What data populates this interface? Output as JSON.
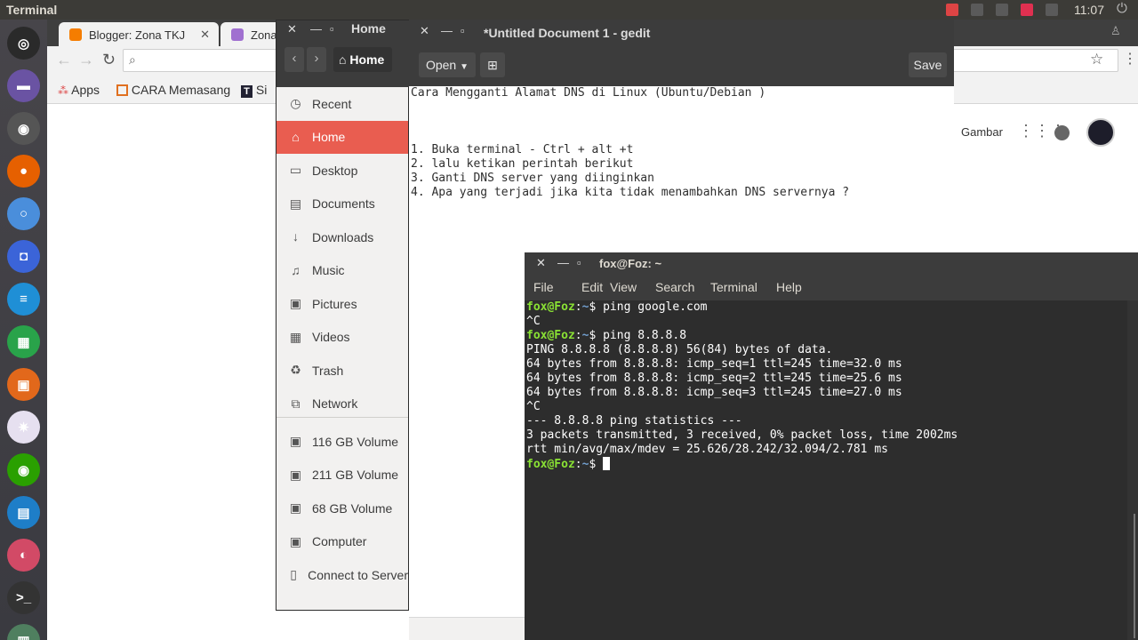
{
  "top_panel": {
    "app_title": "Terminal",
    "clock": "11:07",
    "indicators": [
      {
        "icon": "record-icon",
        "color": "#d44"
      },
      {
        "icon": "wifi-icon",
        "color": "#5a5a5a"
      },
      {
        "icon": "keyboard-en-icon",
        "color": "#5a5a5a"
      },
      {
        "icon": "battery-icon",
        "color": "#e03050"
      },
      {
        "icon": "volume-icon",
        "color": "#5a5a5a"
      }
    ]
  },
  "launcher": {
    "items": [
      {
        "name": "dash-icon",
        "color": "#2a2a2a",
        "glyph": "◎"
      },
      {
        "name": "files-icon",
        "color": "#6a53a3",
        "glyph": "▬"
      },
      {
        "name": "disk-icon",
        "color": "#555",
        "glyph": "◉"
      },
      {
        "name": "firefox-icon",
        "color": "#e66000",
        "glyph": "●"
      },
      {
        "name": "chromium-icon",
        "color": "#4a8edb",
        "glyph": "○"
      },
      {
        "name": "camera-icon",
        "color": "#3b64d8",
        "glyph": "◘"
      },
      {
        "name": "writer-icon",
        "color": "#1f8fd6",
        "glyph": "≡"
      },
      {
        "name": "calc-icon",
        "color": "#29a34a",
        "glyph": "▦"
      },
      {
        "name": "impress-icon",
        "color": "#e2681b",
        "glyph": "▣"
      },
      {
        "name": "atom-icon",
        "color": "#e6e0f0",
        "glyph": "✷"
      },
      {
        "name": "nvidia-icon",
        "color": "#2aa000",
        "glyph": "◉"
      },
      {
        "name": "monitor-icon",
        "color": "#1e7ec8",
        "glyph": "▤"
      },
      {
        "name": "toggle-icon",
        "color": "#d24a66",
        "glyph": "◐"
      },
      {
        "name": "terminal-icon",
        "color": "#333",
        "glyph": ">_"
      },
      {
        "name": "hardware-icon",
        "color": "#4f7f5f",
        "glyph": "▥"
      }
    ]
  },
  "browser": {
    "tabs": [
      {
        "label": "Blogger: Zona TKJ",
        "favicon_color": "#f57d00"
      },
      {
        "label": "Zona",
        "favicon_color": "#a070d0"
      }
    ],
    "bookmarks": [
      {
        "label": "Apps",
        "icon": "apps-grid-icon"
      },
      {
        "label": "CARA Memasang",
        "icon": "bookmark-c-icon"
      },
      {
        "label": "Si",
        "icon": "bookmark-t-icon"
      }
    ],
    "google_bar": {
      "images_label": "Gambar"
    }
  },
  "files": {
    "title": "Home",
    "path_button": "Home",
    "sidebar": [
      {
        "label": "Recent",
        "icon": "clock-icon",
        "glyph": "◷"
      },
      {
        "label": "Home",
        "icon": "home-icon",
        "glyph": "⌂",
        "active": true
      },
      {
        "label": "Desktop",
        "icon": "desktop-icon",
        "glyph": "▭"
      },
      {
        "label": "Documents",
        "icon": "document-icon",
        "glyph": "▤"
      },
      {
        "label": "Downloads",
        "icon": "download-icon",
        "glyph": "↓"
      },
      {
        "label": "Music",
        "icon": "music-icon",
        "glyph": "♫"
      },
      {
        "label": "Pictures",
        "icon": "picture-icon",
        "glyph": "▣"
      },
      {
        "label": "Videos",
        "icon": "video-icon",
        "glyph": "▦"
      },
      {
        "label": "Trash",
        "icon": "trash-icon",
        "glyph": "♻"
      },
      {
        "label": "Network",
        "icon": "network-icon",
        "glyph": "⧉"
      },
      {
        "label": "116 GB Volume",
        "icon": "drive-icon",
        "glyph": "▣"
      },
      {
        "label": "211 GB Volume",
        "icon": "drive-icon",
        "glyph": "▣"
      },
      {
        "label": "68 GB Volume",
        "icon": "drive-icon",
        "glyph": "▣"
      },
      {
        "label": "Computer",
        "icon": "computer-icon",
        "glyph": "▣"
      },
      {
        "label": "Connect to Server",
        "icon": "server-icon",
        "glyph": "▯"
      }
    ]
  },
  "gedit": {
    "title": "*Untitled Document 1 - gedit",
    "open_label": "Open",
    "save_label": "Save",
    "lines": [
      "Cara Mengganti Alamat DNS di Linux (Ubuntu/Debian )",
      "",
      "",
      "",
      "1. Buka terminal - Ctrl + alt +t",
      "2. lalu ketikan perintah berikut",
      "3. Ganti DNS server yang diinginkan",
      "4. Apa yang terjadi jika kita tidak menambahkan DNS servernya ?"
    ]
  },
  "terminal": {
    "title": "fox@Foz: ~",
    "menu": [
      "File",
      "Edit",
      "View",
      "Search",
      "Terminal",
      "Help"
    ],
    "user_host": "fox@Foz",
    "path": "~",
    "lines": [
      {
        "type": "cmd",
        "text": "ping google.com"
      },
      {
        "type": "out",
        "text": "^C"
      },
      {
        "type": "cmd",
        "text": "ping 8.8.8.8"
      },
      {
        "type": "out",
        "text": "PING 8.8.8.8 (8.8.8.8) 56(84) bytes of data."
      },
      {
        "type": "out",
        "text": "64 bytes from 8.8.8.8: icmp_seq=1 ttl=245 time=32.0 ms"
      },
      {
        "type": "out",
        "text": "64 bytes from 8.8.8.8: icmp_seq=2 ttl=245 time=25.6 ms"
      },
      {
        "type": "out",
        "text": "64 bytes from 8.8.8.8: icmp_seq=3 ttl=245 time=27.0 ms"
      },
      {
        "type": "out",
        "text": "^C"
      },
      {
        "type": "out",
        "text": "--- 8.8.8.8 ping statistics ---"
      },
      {
        "type": "out",
        "text": "3 packets transmitted, 3 received, 0% packet loss, time 2002ms"
      },
      {
        "type": "out",
        "text": "rtt min/avg/max/mdev = 25.626/28.242/32.094/2.781 ms"
      },
      {
        "type": "cmd",
        "text": ""
      }
    ]
  }
}
